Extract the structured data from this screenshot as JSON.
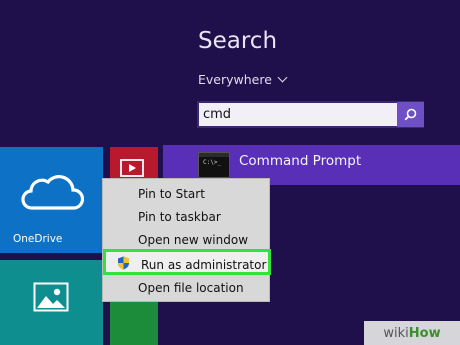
{
  "search": {
    "title": "Search",
    "scope": "Everywhere",
    "query": "cmd",
    "button_icon": "search-icon"
  },
  "results": [
    {
      "label": "Command Prompt",
      "icon": "cmd-icon",
      "icon_text": "C:\\>_"
    }
  ],
  "tiles": {
    "onedrive_label": "OneDrive"
  },
  "context_menu": {
    "items": [
      {
        "label": "Pin to Start"
      },
      {
        "label": "Pin to taskbar"
      },
      {
        "label": "Open new window"
      },
      {
        "label": "Run as administrator",
        "icon": "shield-icon",
        "highlighted": true
      },
      {
        "label": "Open file location"
      }
    ]
  },
  "watermark": {
    "part1": "wiki",
    "part2": "How"
  },
  "colors": {
    "background": "#1f0f4a",
    "result_highlight": "#5a2fb8",
    "menu_highlight_border": "#32e340"
  }
}
